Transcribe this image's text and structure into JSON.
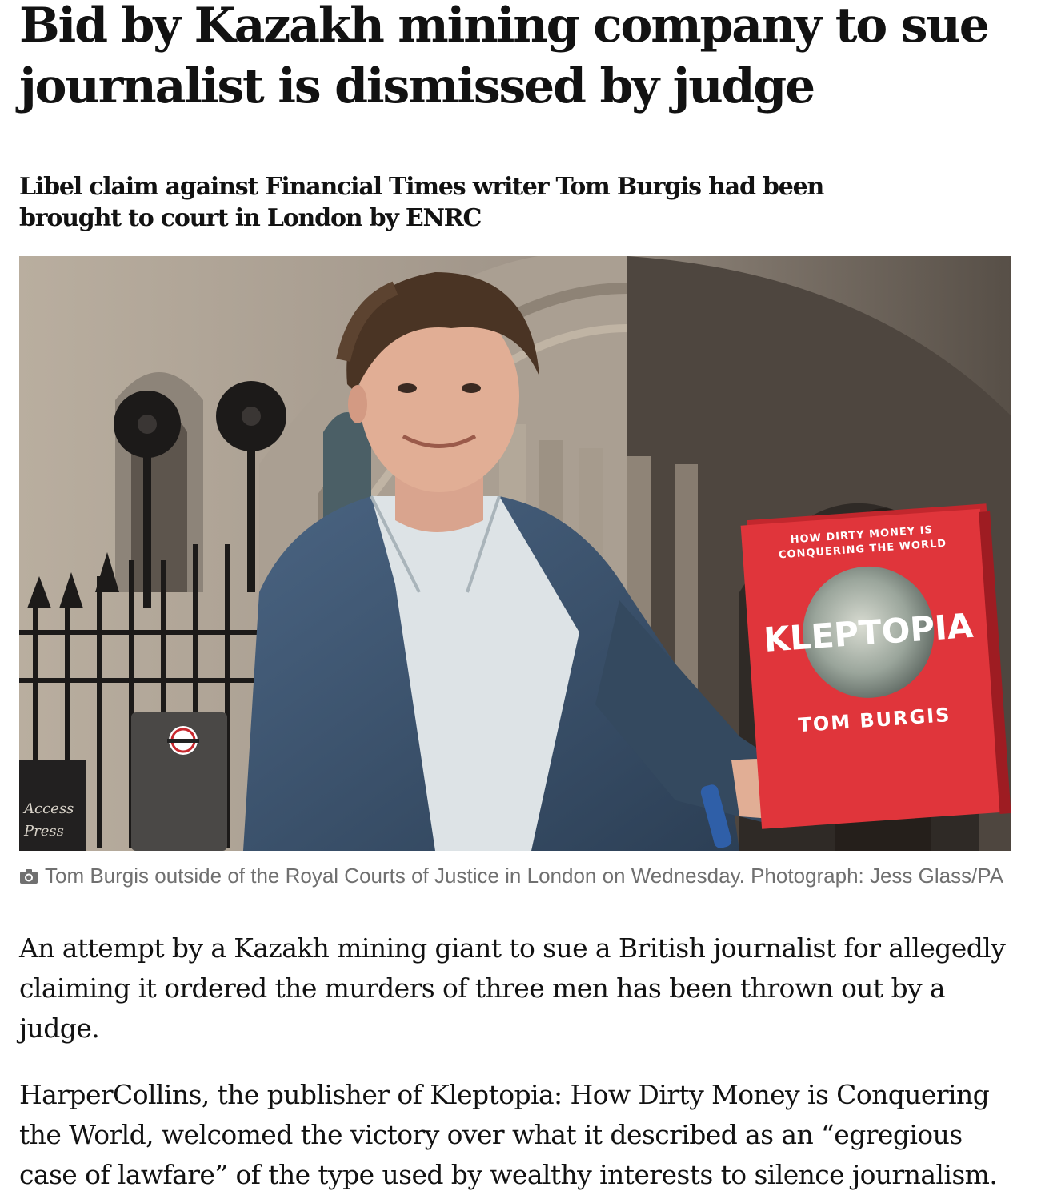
{
  "article": {
    "headline": "Bid by Kazakh mining company to sue journalist is dismissed by judge",
    "standfirst": "Libel claim against Financial Times writer Tom Burgis had been brought to court in London by ENRC",
    "image": {
      "book_tagline": "HOW DIRTY MONEY IS CONQUERING THE WORLD",
      "book_title": "KLEPTOPIA",
      "book_author": "TOM BURGIS",
      "sign_text": [
        "Access",
        "Press"
      ],
      "colors": {
        "book_red": "#e0353b",
        "jacket_blue": "#3b536e",
        "stone": "#a89c8c"
      }
    },
    "caption": {
      "icon": "camera-icon",
      "text": "Tom Burgis outside of the Royal Courts of Justice in London on Wednesday. Photograph: Jess Glass/PA"
    },
    "paragraphs": [
      "An attempt by a Kazakh mining giant to sue a British journalist for allegedly claiming it ordered the murders of three men has been thrown out by a judge.",
      "HarperCollins, the publisher of Kleptopia: How Dirty Money is Conquering the World, welcomed the victory over what it described as an “egregious case of lawfare” of the type used by wealthy interests to silence journalism."
    ]
  }
}
